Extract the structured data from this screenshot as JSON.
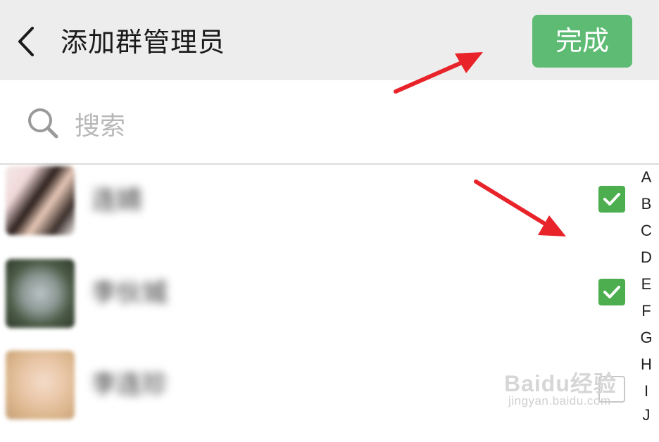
{
  "header": {
    "title": "添加群管理员",
    "done_label": "完成",
    "back_icon": "chevron-left-icon",
    "background": "#ededed",
    "done_color": "#5dbb73"
  },
  "search": {
    "placeholder": "搜索",
    "icon": "search-icon"
  },
  "contacts": [
    {
      "name": "连婧",
      "checked": true
    },
    {
      "name": "李伙城",
      "checked": true
    },
    {
      "name": "李连珍",
      "checked": false
    }
  ],
  "index_letters": [
    "A",
    "B",
    "C",
    "D",
    "E",
    "F",
    "G",
    "H",
    "I",
    "J"
  ],
  "watermark": {
    "logo": "Baidu经验",
    "url_text": "jingyan.baidu.com"
  },
  "annotation_color": "#e8242a",
  "check_color": "#4cae4f"
}
